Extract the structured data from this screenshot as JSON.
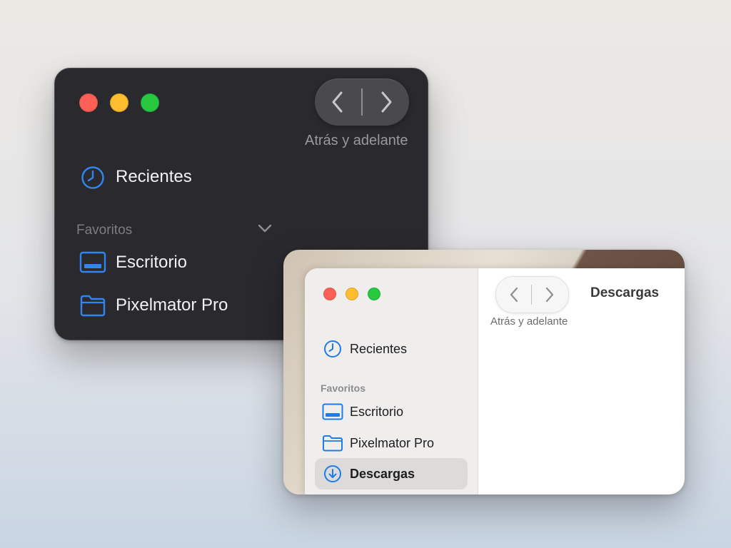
{
  "colors": {
    "close": "#fe5f57",
    "minimize": "#febc2e",
    "zoom": "#28c840",
    "accent": "#1e7ce8"
  },
  "dark_window": {
    "nav_caption": "Atrás y adelante",
    "recents_label": "Recientes",
    "favorites_header": "Favoritos",
    "items": [
      {
        "label": "Escritorio",
        "icon": "desktop-icon"
      },
      {
        "label": "Pixelmator Pro",
        "icon": "folder-icon"
      }
    ]
  },
  "light_window": {
    "title": "Descargas",
    "nav_caption": "Atrás y adelante",
    "recents_label": "Recientes",
    "favorites_header": "Favoritos",
    "items": [
      {
        "label": "Escritorio",
        "icon": "desktop-icon"
      },
      {
        "label": "Pixelmator Pro",
        "icon": "folder-icon"
      },
      {
        "label": "Descargas",
        "icon": "download-icon",
        "selected": true
      }
    ]
  }
}
